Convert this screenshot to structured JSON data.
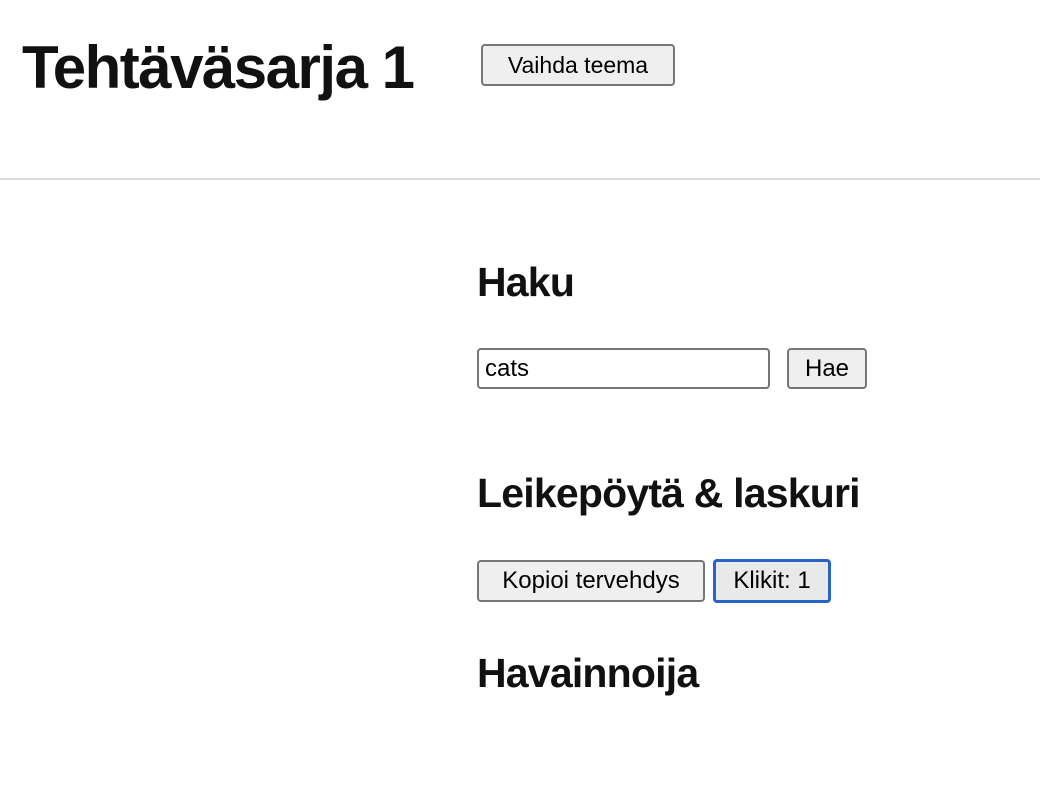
{
  "header": {
    "title": "Tehtäväsarja 1",
    "theme_button": "Vaihda teema"
  },
  "search": {
    "heading": "Haku",
    "input_value": "cats",
    "button": "Hae"
  },
  "clipboard": {
    "heading": "Leikepöytä & laskuri",
    "copy_button": "Kopioi tervehdys",
    "counter_button": "Klikit: 1"
  },
  "observer": {
    "heading": "Havainnoija"
  },
  "colors": {
    "focus": "#2a64c8"
  }
}
